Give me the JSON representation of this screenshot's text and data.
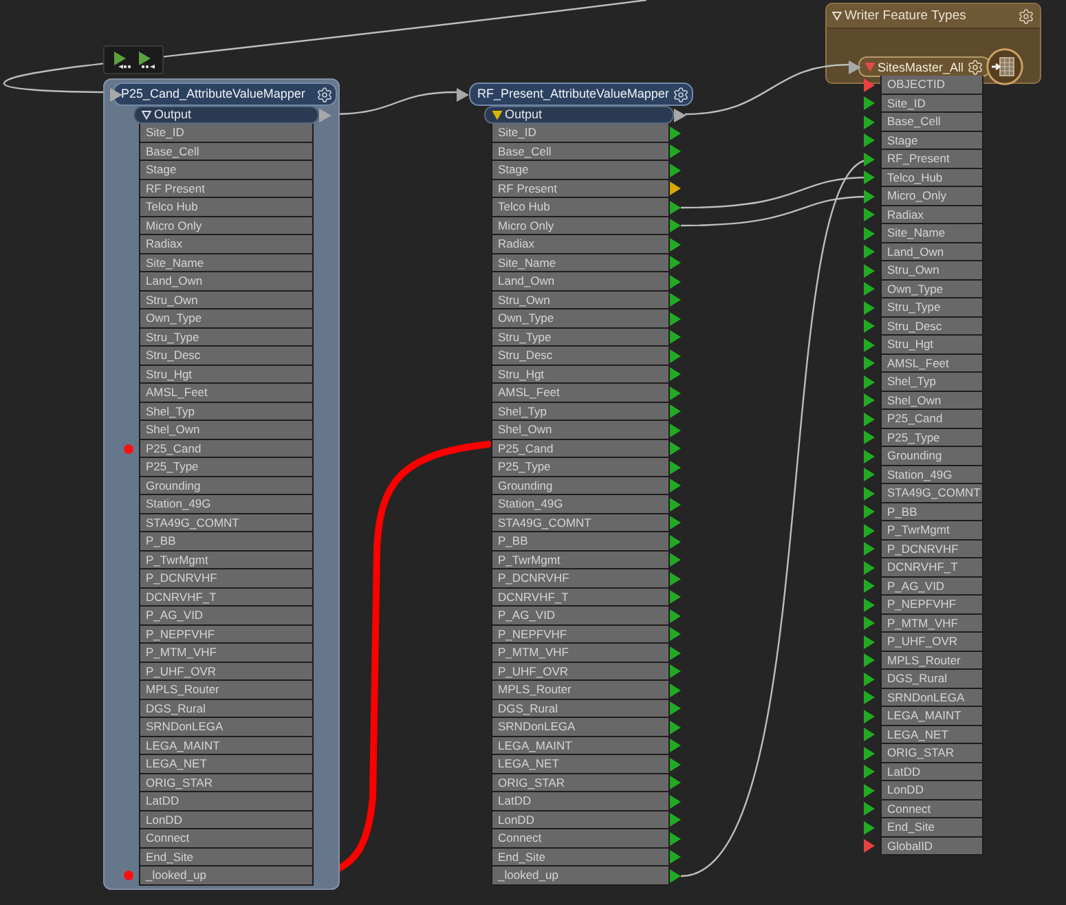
{
  "transformers": [
    {
      "title": "P25_Cand_AttributeValueMapper",
      "selected": true,
      "output": {
        "label": "Output",
        "filled": false
      },
      "attributes": [
        {
          "name": "Site_ID",
          "marked": false
        },
        {
          "name": "Base_Cell",
          "marked": false
        },
        {
          "name": "Stage",
          "marked": false
        },
        {
          "name": "RF Present",
          "marked": false
        },
        {
          "name": "Telco Hub",
          "marked": false
        },
        {
          "name": "Micro Only",
          "marked": false
        },
        {
          "name": "Radiax",
          "marked": false
        },
        {
          "name": "Site_Name",
          "marked": false
        },
        {
          "name": "Land_Own",
          "marked": false
        },
        {
          "name": "Stru_Own",
          "marked": false
        },
        {
          "name": "Own_Type",
          "marked": false
        },
        {
          "name": "Stru_Type",
          "marked": false
        },
        {
          "name": "Stru_Desc",
          "marked": false
        },
        {
          "name": "Stru_Hgt",
          "marked": false
        },
        {
          "name": "AMSL_Feet",
          "marked": false
        },
        {
          "name": "Shel_Typ",
          "marked": false
        },
        {
          "name": "Shel_Own",
          "marked": false
        },
        {
          "name": "P25_Cand",
          "marked": true
        },
        {
          "name": "P25_Type",
          "marked": false
        },
        {
          "name": "Grounding",
          "marked": false
        },
        {
          "name": "Station_49G",
          "marked": false
        },
        {
          "name": "STA49G_COMNT",
          "marked": false
        },
        {
          "name": "P_BB",
          "marked": false
        },
        {
          "name": "P_TwrMgmt",
          "marked": false
        },
        {
          "name": "P_DCNRVHF",
          "marked": false
        },
        {
          "name": "DCNRVHF_T",
          "marked": false
        },
        {
          "name": "P_AG_VID",
          "marked": false
        },
        {
          "name": "P_NEPFVHF",
          "marked": false
        },
        {
          "name": "P_MTM_VHF",
          "marked": false
        },
        {
          "name": "P_UHF_OVR",
          "marked": false
        },
        {
          "name": "MPLS_Router",
          "marked": false
        },
        {
          "name": "DGS_Rural",
          "marked": false
        },
        {
          "name": "SRNDonLEGA",
          "marked": false
        },
        {
          "name": "LEGA_MAINT",
          "marked": false
        },
        {
          "name": "LEGA_NET",
          "marked": false
        },
        {
          "name": "ORIG_STAR",
          "marked": false
        },
        {
          "name": "LatDD",
          "marked": false
        },
        {
          "name": "LonDD",
          "marked": false
        },
        {
          "name": "Connect",
          "marked": false
        },
        {
          "name": "End_Site",
          "marked": false
        },
        {
          "name": "_looked_up",
          "marked": true
        }
      ]
    },
    {
      "title": "RF_Present_AttributeValueMapper",
      "selected": false,
      "output": {
        "label": "Output",
        "filled": true
      },
      "attributes": [
        {
          "name": "Site_ID",
          "color": "#22aa22"
        },
        {
          "name": "Base_Cell",
          "color": "#22aa22"
        },
        {
          "name": "Stage",
          "color": "#22aa22"
        },
        {
          "name": "RF Present",
          "color": "#d8a800"
        },
        {
          "name": "Telco Hub",
          "color": "#22aa22"
        },
        {
          "name": "Micro Only",
          "color": "#22aa22"
        },
        {
          "name": "Radiax",
          "color": "#22aa22"
        },
        {
          "name": "Site_Name",
          "color": "#22aa22"
        },
        {
          "name": "Land_Own",
          "color": "#22aa22"
        },
        {
          "name": "Stru_Own",
          "color": "#22aa22"
        },
        {
          "name": "Own_Type",
          "color": "#22aa22"
        },
        {
          "name": "Stru_Type",
          "color": "#22aa22"
        },
        {
          "name": "Stru_Desc",
          "color": "#22aa22"
        },
        {
          "name": "Stru_Hgt",
          "color": "#22aa22"
        },
        {
          "name": "AMSL_Feet",
          "color": "#22aa22"
        },
        {
          "name": "Shel_Typ",
          "color": "#22aa22"
        },
        {
          "name": "Shel_Own",
          "color": "#22aa22"
        },
        {
          "name": "P25_Cand",
          "color": "#22aa22"
        },
        {
          "name": "P25_Type",
          "color": "#22aa22"
        },
        {
          "name": "Grounding",
          "color": "#22aa22"
        },
        {
          "name": "Station_49G",
          "color": "#22aa22"
        },
        {
          "name": "STA49G_COMNT",
          "color": "#22aa22"
        },
        {
          "name": "P_BB",
          "color": "#22aa22"
        },
        {
          "name": "P_TwrMgmt",
          "color": "#22aa22"
        },
        {
          "name": "P_DCNRVHF",
          "color": "#22aa22"
        },
        {
          "name": "DCNRVHF_T",
          "color": "#22aa22"
        },
        {
          "name": "P_AG_VID",
          "color": "#22aa22"
        },
        {
          "name": "P_NEPFVHF",
          "color": "#22aa22"
        },
        {
          "name": "P_MTM_VHF",
          "color": "#22aa22"
        },
        {
          "name": "P_UHF_OVR",
          "color": "#22aa22"
        },
        {
          "name": "MPLS_Router",
          "color": "#22aa22"
        },
        {
          "name": "DGS_Rural",
          "color": "#22aa22"
        },
        {
          "name": "SRNDonLEGA",
          "color": "#22aa22"
        },
        {
          "name": "LEGA_MAINT",
          "color": "#22aa22"
        },
        {
          "name": "LEGA_NET",
          "color": "#22aa22"
        },
        {
          "name": "ORIG_STAR",
          "color": "#22aa22"
        },
        {
          "name": "LatDD",
          "color": "#22aa22"
        },
        {
          "name": "LonDD",
          "color": "#22aa22"
        },
        {
          "name": "Connect",
          "color": "#22aa22"
        },
        {
          "name": "End_Site",
          "color": "#22aa22"
        },
        {
          "name": "_looked_up",
          "color": "#22aa22"
        }
      ]
    }
  ],
  "writer_bookmark": {
    "title": "Writer Feature Types",
    "expanded": true,
    "feature_type": {
      "name": "SitesMaster_All",
      "expanded": true,
      "attributes": [
        {
          "name": "OBJECTID",
          "color": "#e84040"
        },
        {
          "name": "Site_ID",
          "color": "#22aa22"
        },
        {
          "name": "Base_Cell",
          "color": "#22aa22"
        },
        {
          "name": "Stage",
          "color": "#22aa22"
        },
        {
          "name": "RF_Present",
          "color": "#22aa22"
        },
        {
          "name": "Telco_Hub",
          "color": "#22aa22"
        },
        {
          "name": "Micro_Only",
          "color": "#22aa22"
        },
        {
          "name": "Radiax",
          "color": "#22aa22"
        },
        {
          "name": "Site_Name",
          "color": "#22aa22"
        },
        {
          "name": "Land_Own",
          "color": "#22aa22"
        },
        {
          "name": "Stru_Own",
          "color": "#22aa22"
        },
        {
          "name": "Own_Type",
          "color": "#22aa22"
        },
        {
          "name": "Stru_Type",
          "color": "#22aa22"
        },
        {
          "name": "Stru_Desc",
          "color": "#22aa22"
        },
        {
          "name": "Stru_Hgt",
          "color": "#22aa22"
        },
        {
          "name": "AMSL_Feet",
          "color": "#22aa22"
        },
        {
          "name": "Shel_Typ",
          "color": "#22aa22"
        },
        {
          "name": "Shel_Own",
          "color": "#22aa22"
        },
        {
          "name": "P25_Cand",
          "color": "#22aa22"
        },
        {
          "name": "P25_Type",
          "color": "#22aa22"
        },
        {
          "name": "Grounding",
          "color": "#22aa22"
        },
        {
          "name": "Station_49G",
          "color": "#22aa22"
        },
        {
          "name": "STA49G_COMNT",
          "color": "#22aa22"
        },
        {
          "name": "P_BB",
          "color": "#22aa22"
        },
        {
          "name": "P_TwrMgmt",
          "color": "#22aa22"
        },
        {
          "name": "P_DCNRVHF",
          "color": "#22aa22"
        },
        {
          "name": "DCNRVHF_T",
          "color": "#22aa22"
        },
        {
          "name": "P_AG_VID",
          "color": "#22aa22"
        },
        {
          "name": "P_NEPFVHF",
          "color": "#22aa22"
        },
        {
          "name": "P_MTM_VHF",
          "color": "#22aa22"
        },
        {
          "name": "P_UHF_OVR",
          "color": "#22aa22"
        },
        {
          "name": "MPLS_Router",
          "color": "#22aa22"
        },
        {
          "name": "DGS_Rural",
          "color": "#22aa22"
        },
        {
          "name": "SRNDonLEGA",
          "color": "#22aa22"
        },
        {
          "name": "LEGA_MAINT",
          "color": "#22aa22"
        },
        {
          "name": "LEGA_NET",
          "color": "#22aa22"
        },
        {
          "name": "ORIG_STAR",
          "color": "#22aa22"
        },
        {
          "name": "LatDD",
          "color": "#22aa22"
        },
        {
          "name": "LonDD",
          "color": "#22aa22"
        },
        {
          "name": "Connect",
          "color": "#22aa22"
        },
        {
          "name": "End_Site",
          "color": "#22aa22"
        },
        {
          "name": "GlobalID",
          "color": "#e84040"
        }
      ]
    }
  }
}
